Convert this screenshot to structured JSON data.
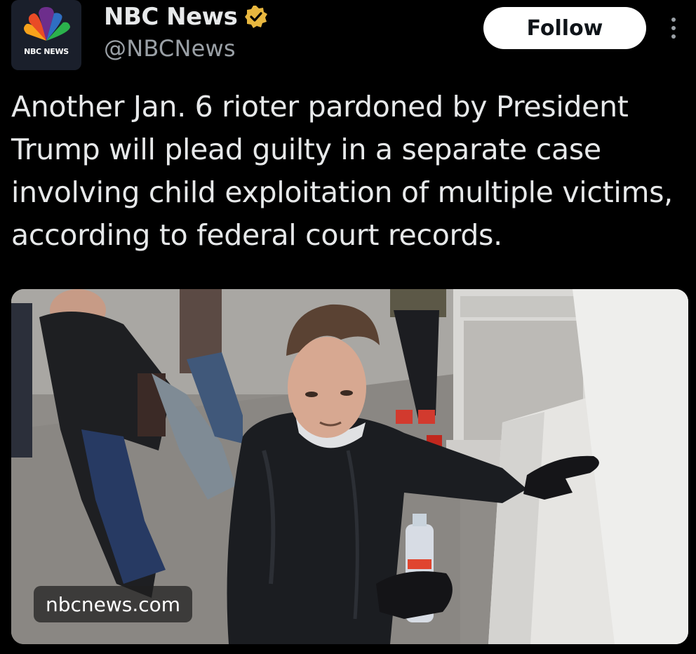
{
  "account": {
    "name": "NBC News",
    "handle": "@NBCNews",
    "avatar_label": "NBC NEWS",
    "avatar_icon": "nbc-peacock-logo",
    "verified_icon": "gold-verified-badge",
    "verified_color": "#e8b73f"
  },
  "actions": {
    "follow_label": "Follow",
    "more_icon": "vertical-ellipsis"
  },
  "tweet": {
    "text": "Another Jan. 6 rioter pardoned by President Trump will plead guilty in a separate case involving child exploitation of multiple victims, according to federal court records."
  },
  "media": {
    "link_domain": "nbcnews.com"
  },
  "colors": {
    "background": "#000000",
    "text": "#e7e9ea",
    "secondary_text": "#9aa0a6",
    "follow_button_bg": "#ffffff"
  }
}
